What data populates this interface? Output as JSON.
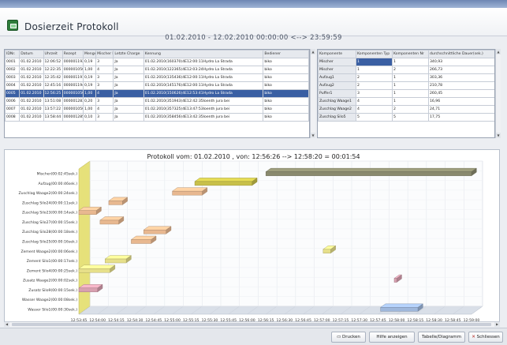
{
  "window": {
    "title": "Dosierzeit Protokoll",
    "date_range": "01.02.2010 - 12.02.2010  00:00:00 <--> 23:59:59"
  },
  "left_table": {
    "columns": [
      "IDNr.",
      "Datum",
      "Uhrzeit",
      "Rezept",
      "Menge",
      "Mischer Nr.",
      "Letzte Charge",
      "Kennung",
      "Bediener"
    ],
    "rows": [
      [
        "0001",
        "01.02.2010",
        "12:06:52",
        "000001192",
        "0,19",
        "3",
        "Ja",
        "01.02.2010(160370)4E12:00:11Hydro La Strada",
        "biko"
      ],
      [
        "0002",
        "01.02.2010",
        "12:22:35",
        "000001050",
        "1,00",
        "4",
        "Ja",
        "01.02.2010(122365)4E12:03:24Hydro La Strada",
        "biko"
      ],
      [
        "0003",
        "01.02.2010",
        "12:35:42",
        "000001191",
        "0,19",
        "3",
        "Ja",
        "01.02.2010(135436)4E12:00:11Hydro La Strada",
        "biko"
      ],
      [
        "0004",
        "01.02.2010",
        "12:45:16",
        "000001194",
        "0,19",
        "3",
        "Ja",
        "01.02.2010(145176)4E12:00:11Hydro La Strada",
        "biko"
      ],
      [
        "0005",
        "01.02.2010",
        "12:56:25",
        "000001050",
        "1,00",
        "4",
        "Ja",
        "01.02.2010(150626)4E12:53:41Hydro La Strada",
        "biko"
      ],
      [
        "0006",
        "01.02.2010",
        "13:51:08",
        "000001283",
        "0,20",
        "3",
        "Ja",
        "01.02.2010(351943)4E12:42:35Ioenth jura bei",
        "biko"
      ],
      [
        "0007",
        "01.02.2010",
        "13:57:22",
        "000001050",
        "1,00",
        "4",
        "Ja",
        "01.02.2010(357325)4E13:47:53Ioenth jura bei",
        "biko"
      ],
      [
        "0008",
        "01.02.2010",
        "13:58:44",
        "000001285",
        "0,10",
        "3",
        "Ja",
        "01.02.2010(358456)4E13:42:35Ioenth jura bei",
        "biko"
      ]
    ]
  },
  "right_table": {
    "columns": [
      "Komponente",
      "Komponenten Typ",
      "Komponenten Nr",
      "durchschnittliche Dauer(sek.)"
    ],
    "rows": [
      [
        "Mischer",
        "1",
        "1",
        "340,93"
      ],
      [
        "Mischer",
        "1",
        "2",
        "266,73"
      ],
      [
        "Aufzug1",
        "2",
        "1",
        "303,36"
      ],
      [
        "Aufzug2",
        "2",
        "1",
        "210,78"
      ],
      [
        "Puffer1",
        "3",
        "1",
        "260,45"
      ],
      [
        "Zuschlag Waage1",
        "4",
        "1",
        "16,96"
      ],
      [
        "Zuschlag Waage2",
        "4",
        "2",
        "24,71"
      ],
      [
        "Zuschlag Silo5",
        "5",
        "5",
        "17,75"
      ]
    ]
  },
  "chart": {
    "title": "Protokoll vom: 01.02.2010 , von: 12:56:26 --> 12:58:20 = 00:01:54"
  },
  "buttons": {
    "drucken": "Drucken",
    "hilfe": "Hilfe anzeigen",
    "tabelle": "Tabelle/Diagramm",
    "schliessen": "Schliessen"
  },
  "colors": {
    "selection": "#3a5fa3",
    "chart_floor": "#d9dfe8",
    "accent_wall": "#e6e17a"
  },
  "chart_data": {
    "type": "bar",
    "orientation": "horizontal-gantt",
    "title": "Protokoll vom: 01.02.2010 , von: 12:56:26 --> 12:58:20 = 00:01:54",
    "categories": [
      "Mischer(00:02:45sek.)",
      "Aufzug(00:00:46sek.)",
      "Zuschlag Waage2(00:00:24sek.)",
      "Zuschlag Silo24(00:00:11sek.)",
      "Zuschlag Silo23(00:00:14sek.)",
      "Zuschlag Silo27(00:00:15sek.)",
      "Zuschlag Silo28(00:00:18sek.)",
      "Zuschlag Silo25(00:00:16sek.)",
      "Zement Waage2(00:00:06sek.)",
      "Zement Silo1(00:00:17sek.)",
      "Zement Silo4(00:00:25sek.)",
      "Zusatz Waage2(00:00:02sek.)",
      "Zusatz Silo9(00:00:15sek.)",
      "Wasser Waage2(00:00:08sek.)",
      "Wasser Silo1(00:00:30sek.)"
    ],
    "x_ticks": [
      "12:53:45",
      "12:54:00",
      "12:54:15",
      "12:54:30",
      "12:54:45",
      "12:55:00",
      "12:55:15",
      "12:55:30",
      "12:55:45",
      "12:56:00",
      "12:56:15",
      "12:56:30",
      "12:56:45",
      "12:57:00",
      "12:57:15",
      "12:57:30",
      "12:57:45",
      "12:58:00",
      "12:58:15",
      "12:58:30",
      "12:58:45",
      "12:59:00"
    ],
    "series": [
      {
        "category": "Mischer(00:02:45sek.)",
        "start": "12:56:15",
        "end": "12:59:00",
        "color": "#8a8a6e"
      },
      {
        "category": "Aufzug(00:00:46sek.)",
        "start": "12:55:18",
        "end": "12:56:04",
        "color": "#c8c04a"
      },
      {
        "category": "Zuschlag Waage2(00:00:24sek.)",
        "start": "12:55:00",
        "end": "12:55:24",
        "color": "#e8b890"
      },
      {
        "category": "Zuschlag Silo24(00:00:11sek.)",
        "start": "12:54:09",
        "end": "12:54:20",
        "color": "#e8b890"
      },
      {
        "category": "Zuschlag Silo23(00:00:14sek.)",
        "start": "12:53:45",
        "end": "12:53:59",
        "color": "#e8b890"
      },
      {
        "category": "Zuschlag Silo27(00:00:15sek.)",
        "start": "12:54:02",
        "end": "12:54:17",
        "color": "#e8b890"
      },
      {
        "category": "Zuschlag Silo28(00:00:18sek.)",
        "start": "12:54:37",
        "end": "12:54:55",
        "color": "#e8b890"
      },
      {
        "category": "Zuschlag Silo25(00:00:16sek.)",
        "start": "12:54:27",
        "end": "12:54:43",
        "color": "#e8b890"
      },
      {
        "category": "Zement Waage2(00:00:06sek.)",
        "start": "12:57:01",
        "end": "12:57:07",
        "color": "#e6df8a"
      },
      {
        "category": "Zement Silo1(00:00:17sek.)",
        "start": "12:54:06",
        "end": "12:54:23",
        "color": "#e6df8a"
      },
      {
        "category": "Zement Silo4(00:00:25sek.)",
        "start": "12:53:45",
        "end": "12:54:10",
        "color": "#e6df8a"
      },
      {
        "category": "Zusatz Waage2(00:00:02sek.)",
        "start": "12:57:58",
        "end": "12:58:00",
        "color": "#d8a0b0"
      },
      {
        "category": "Zusatz Silo9(00:00:15sek.)",
        "start": "12:53:45",
        "end": "12:54:00",
        "color": "#d8a0b0"
      },
      {
        "category": "Wasser Waage2(00:00:08sek.)",
        "start": "",
        "end": "",
        "color": "#9fb8dc"
      },
      {
        "category": "Wasser Silo1(00:00:30sek.)",
        "start": "12:57:47",
        "end": "12:58:17",
        "color": "#9fb8dc"
      }
    ],
    "grid": true,
    "legend": "none"
  }
}
